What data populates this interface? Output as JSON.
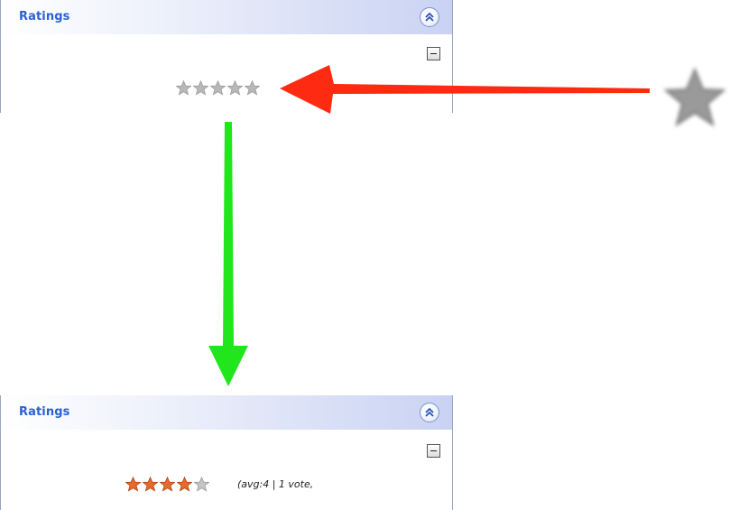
{
  "top_panel": {
    "title": "Ratings",
    "collapse_icon": "double-chevron-up-icon",
    "minimize_icon": "minus-box-icon",
    "rating_value": 0,
    "rating_max": 5,
    "star_color_empty": "#b8b8b8"
  },
  "bottom_panel": {
    "title": "Ratings",
    "collapse_icon": "double-chevron-up-icon",
    "minimize_icon": "minus-box-icon",
    "rating_value": 4,
    "rating_max": 5,
    "star_color_filled": "#e8692a",
    "star_color_empty": "#c4c4c4",
    "avg_text": "(avg:4 | 1 vote,"
  },
  "annotations": {
    "red_arrow_color": "#ff2a12",
    "green_arrow_color": "#22e61c",
    "blurred_star_icon": "star-icon"
  }
}
